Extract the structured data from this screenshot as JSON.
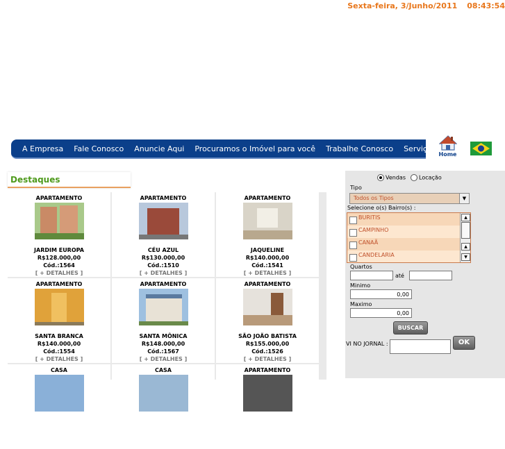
{
  "header": {
    "date": "Sexta-feira, 3/Junho/2011",
    "time": "08:43:54"
  },
  "nav": [
    "A Empresa",
    "Fale Conosco",
    "Anuncie Aqui",
    "Procuramos o Imóvel para você",
    "Trabalhe Conosco",
    "Serviços Uteis"
  ],
  "home_label": "Home",
  "destaques_title": "Destaques",
  "cards": [
    {
      "type": "APARTAMENTO",
      "name": "JARDIM EUROPA",
      "price": "R$128.000,00",
      "code": "Cód.:1564",
      "more": "[ + DETALHES ]"
    },
    {
      "type": "APARTAMENTO",
      "name": "CÉU AZUL",
      "price": "R$130.000,00",
      "code": "Cód.:1510",
      "more": "[ + DETALHES ]"
    },
    {
      "type": "APARTAMENTO",
      "name": "JAQUELINE",
      "price": "R$140.000,00",
      "code": "Cód.:1541",
      "more": "[ + DETALHES ]"
    },
    {
      "type": "APARTAMENTO",
      "name": "SANTA BRANCA",
      "price": "R$140.000,00",
      "code": "Cód.:1554",
      "more": "[ + DETALHES ]"
    },
    {
      "type": "APARTAMENTO",
      "name": "SANTA MÔNICA",
      "price": "R$148.000,00",
      "code": "Cód.:1567",
      "more": "[ + DETALHES ]"
    },
    {
      "type": "APARTAMENTO",
      "name": "SÃO JOÃO BATISTA",
      "price": "R$155.000,00",
      "code": "Cód.:1526",
      "more": "[ + DETALHES ]"
    },
    {
      "type": "CASA"
    },
    {
      "type": "CASA"
    },
    {
      "type": "APARTAMENTO"
    }
  ],
  "search": {
    "mode_sale": "Vendas",
    "mode_rent": "Locação",
    "tipo_label": "Tipo",
    "tipo_value": "Todos os Tipos",
    "bairro_label": "Selecione o(s)  Bairro(s) :",
    "bairros": [
      "BURITIS",
      "CAMPINHO",
      "CANAÃ",
      "CANDELARIA"
    ],
    "quartos_label": "Quartos",
    "ate_label": "até",
    "minimo_label": "Minimo",
    "minimo_value": "0,00",
    "maximo_label": "Maximo",
    "maximo_value": "0,00",
    "buscar": "BUSCAR",
    "jornal_label": "VI NO JORNAL :",
    "ok": "OK"
  },
  "colors": {
    "accent": "#e8771c",
    "nav": "#0b3f8a",
    "title": "#4e9a1c"
  }
}
